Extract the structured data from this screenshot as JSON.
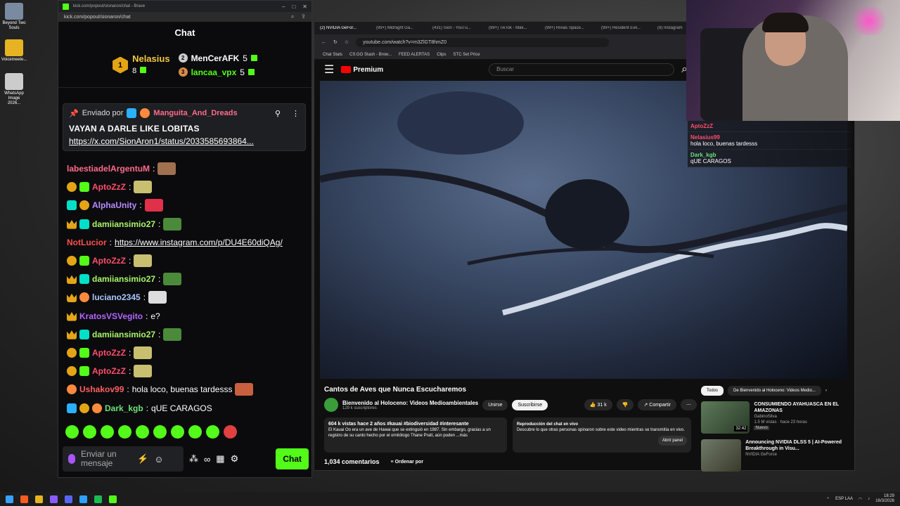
{
  "desktop": {
    "icons": [
      {
        "label": "Beyond Two Souls",
        "color": "#7a8aa0"
      },
      {
        "label": "Voicemeete...",
        "color": "#e6b422"
      },
      {
        "label": "WhatsApp Image 2026...",
        "color": "#ccc"
      }
    ]
  },
  "kick": {
    "window_title": "kick.com/popout/sionaron/chat - Brave",
    "url": "kick.com/popout/sionaron/chat",
    "chat_title": "Chat",
    "leaderboard": {
      "first": {
        "rank": "1",
        "name": "Nelasius",
        "count": "8"
      },
      "others": [
        {
          "rank": "2",
          "name": "MenCerAFK",
          "count": "5"
        },
        {
          "rank": "3",
          "name": "lancaa_vpx",
          "count": "5"
        }
      ]
    },
    "pinned": {
      "by_label": "Enviado por",
      "user": "Manguita_And_Dreads",
      "message": "VAYAN A DARLE LIKE LOBITAS",
      "link": "https://x.com/SionAron1/status/2033585693864..."
    },
    "messages": [
      {
        "badges": [],
        "user": "labestiadelArgentuM",
        "color": "#ff6b8b",
        "sep": ":",
        "text": "",
        "emote": "#a07050"
      },
      {
        "badges": [
          "one",
          "gift"
        ],
        "user": "AptoZzZ",
        "color": "#ff4d6d",
        "sep": ":",
        "text": "",
        "emote": "#c8c070"
      },
      {
        "badges": [
          "sub",
          "one"
        ],
        "user": "AlphaUnity",
        "color": "#b78cff",
        "sep": ":",
        "text": "",
        "emote": "#e0304a"
      },
      {
        "badges": [
          "crown",
          "sub"
        ],
        "user": "damiiansimio27",
        "color": "#a8f56a",
        "sep": ":",
        "text": "",
        "emote": "#4b8a3a"
      },
      {
        "badges": [],
        "user": "NotLucior",
        "color": "#ff4d4d",
        "sep": ":",
        "text": "",
        "link": "https://www.instagram.com/p/DU4E60diQAg/"
      },
      {
        "badges": [
          "one",
          "gift"
        ],
        "user": "AptoZzZ",
        "color": "#ff4d6d",
        "sep": ":",
        "text": "",
        "emote": "#c8c070"
      },
      {
        "badges": [
          "crown",
          "sub"
        ],
        "user": "damiiansimio27",
        "color": "#a8f56a",
        "sep": ":",
        "text": "",
        "emote": "#4b8a3a"
      },
      {
        "badges": [
          "crown",
          "bear"
        ],
        "user": "luciano2345",
        "color": "#a7c7ff",
        "sep": ":",
        "text": "",
        "emote": "#dddddd"
      },
      {
        "badges": [
          "crown"
        ],
        "user": "KratosVSVegito",
        "color": "#b267ff",
        "sep": ":",
        "text": "e?"
      },
      {
        "badges": [
          "crown",
          "sub"
        ],
        "user": "damiiansimio27",
        "color": "#a8f56a",
        "sep": ":",
        "text": "",
        "emote": "#4b8a3a"
      },
      {
        "badges": [
          "one",
          "gift"
        ],
        "user": "AptoZzZ",
        "color": "#ff4d6d",
        "sep": ":",
        "text": "",
        "emote": "#c8c070"
      },
      {
        "badges": [
          "one",
          "gift"
        ],
        "user": "AptoZzZ",
        "color": "#ff4d6d",
        "sep": ":",
        "text": "",
        "emote": "#c8c070"
      },
      {
        "badges": [
          "bear"
        ],
        "user": "Ushakov99",
        "color": "#ff5f5f",
        "sep": ":",
        "text": "hola loco, buenas tardesss",
        "emote": "#c86040"
      },
      {
        "badges": [
          "blue",
          "one",
          "bear"
        ],
        "user": "Dark_kgb",
        "color": "#6ce07a",
        "sep": ":",
        "text": "qUE CARAGOS"
      }
    ],
    "input_placeholder": "Enviar un mensaje",
    "send_label": "Chat"
  },
  "browser": {
    "tabs": [
      "(2) NVIDIA GeFor...",
      "(99+) Midnight Ga...",
      "(431) Sion - YouTu...",
      "(99+) TikTok - Mak...",
      "(99+) Rivias Space...",
      "(99+) Resident Evil...",
      "(9) Instagram"
    ],
    "url": "youtube.com/watch?v=m3ZlGT8hmZ0",
    "bookmarks": [
      "Chat Stats",
      "CS:GO Stash - Brow...",
      "FEED ALERTAS",
      "Clips",
      "STC Set Price"
    ],
    "yt_brand": "Premium",
    "search_placeholder": "Buscar",
    "video_title": "Cantos de Aves que Nunca Escucharemos",
    "channel": "Bienvenido al Holoceno: Videos Medioambientales",
    "subscribers": "129 k suscriptores",
    "join_label": "Unirse",
    "subscribe_label": "Suscribirse",
    "likes": "31 k",
    "share_label": "Compartir",
    "desc_stats": "604 k vistas  hace 2 años  #kauai #biodiversidad #interesante",
    "desc_text": "El Kauai Oo era un ave de Hawai que se extinguió en 1987. Sin embargo, gracias a un registro de su canto hecho por el ornitólogo Thane Pratt, aún poden  ...más",
    "live_title": "Reproducción del chat en vivo",
    "live_text": "Descubre lo que otras personas opinaron sobre este video mientras se transmitía en vivo.",
    "open_panel": "Abrir panel",
    "comments": "1,034 comentarios",
    "sort_label": "Ordenar por",
    "chips": [
      "Todos",
      "De Bienvenido al Holoceno: Videos Medio..."
    ],
    "recs": [
      {
        "title": "CONSUMIENDO AYAHUASCA EN EL AMAZONAS",
        "channel": "GabinoSilva",
        "meta": "1.5 M vistas · hace 23 horas",
        "badge": "Nuevo",
        "duration": "32:42"
      },
      {
        "title": "Announcing NVIDIA DLSS 5 | AI-Powered Breakthrough in Visu...",
        "channel": "NVIDIA GeForce",
        "meta": "",
        "badge": "",
        "duration": ""
      }
    ]
  },
  "overlay": {
    "rows": [
      {
        "name": "AptoZzZ",
        "color": "#ff4d6d",
        "text": ""
      },
      {
        "name": "Nelasius99",
        "color": "#ff4d6d",
        "text": "hola loco, buenas tardesss"
      },
      {
        "name": "Dark_kgb",
        "color": "#6ce07a",
        "text": "qUE CARAGOS"
      }
    ]
  },
  "taskbar": {
    "lang": "ESP LAA",
    "time": "18:29",
    "date": "16/3/2026"
  }
}
